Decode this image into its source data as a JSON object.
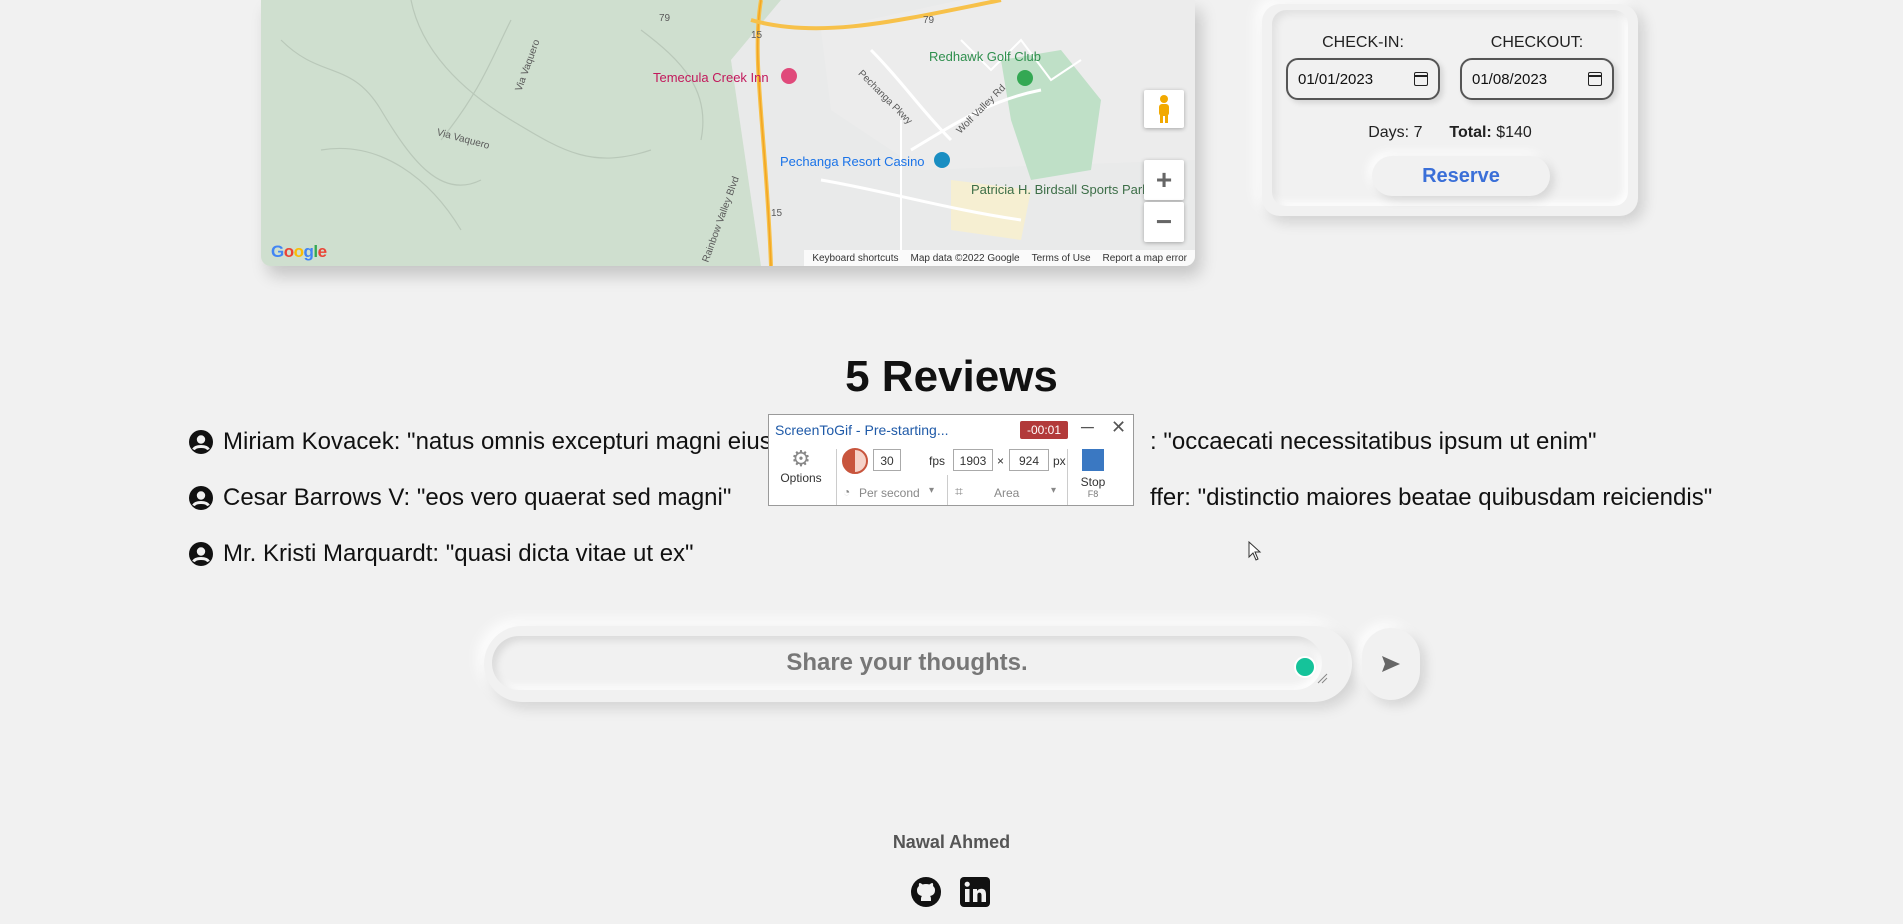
{
  "map": {
    "labels": {
      "redhawk": "Redhawk Golf Club",
      "temecula_inn": "Temecula Creek Inn",
      "casino": "Pechanga Resort Casino",
      "park": "Patricia H. Birdsall Sports Park",
      "via_vaquero_1": "Via Vaquero",
      "via_vaquero_2": "Via Vaquero",
      "pechanga_pkwy": "Pechanga Pkwy",
      "wolf_valley": "Wolf Valley Rd",
      "rainbow_valley": "Rainbow Valley Blvd",
      "hwy_79a": "79",
      "hwy_79b": "79",
      "hwy_15a": "15",
      "hwy_15b": "15"
    },
    "google_logo": "Google",
    "footer": {
      "shortcuts": "Keyboard shortcuts",
      "map_data": "Map data ©2022 Google",
      "terms": "Terms of Use",
      "report": "Report a map error"
    },
    "zoom_in": "+",
    "zoom_out": "−"
  },
  "booking": {
    "checkin_label": "CHECK-IN:",
    "checkin_value": "01/01/2023",
    "checkout_label": "CHECKOUT:",
    "checkout_value": "01/08/2023",
    "days_label": "Days:",
    "days_value": "7",
    "total_label": "Total:",
    "total_value": "$140",
    "reserve_label": "Reserve"
  },
  "reviews": {
    "title": "5 Reviews",
    "items": [
      "Miriam Kovacek: \"natus omnis excepturi magni eius",
      ": \"occaecati necessitatibus ipsum ut enim\"",
      "Cesar Barrows V: \"eos vero quaerat sed magni\"",
      "ffer: \"distinctio maiores beatae quibusdam reiciendis\"",
      "Mr. Kristi Marquardt: \"quasi dicta vitae ut ex\""
    ]
  },
  "comment": {
    "placeholder": "Share your thoughts."
  },
  "footer": {
    "author": "Nawal Ahmed",
    "icons": [
      "github-icon",
      "linkedin-icon"
    ]
  },
  "overlay": {
    "title": "ScreenToGif - Pre-starting...",
    "timer": "-00:01",
    "options": "Options",
    "fps_value": "30",
    "fps_label": "fps",
    "width": "1903",
    "times": "×",
    "height": "924",
    "px": "px",
    "per_second": "Per second",
    "area": "Area",
    "stop": "Stop",
    "stop_key": "F8"
  },
  "colors": {
    "background": "#f1f1f1",
    "accent": "#3a6fd8",
    "timer": "#b23a3a"
  }
}
